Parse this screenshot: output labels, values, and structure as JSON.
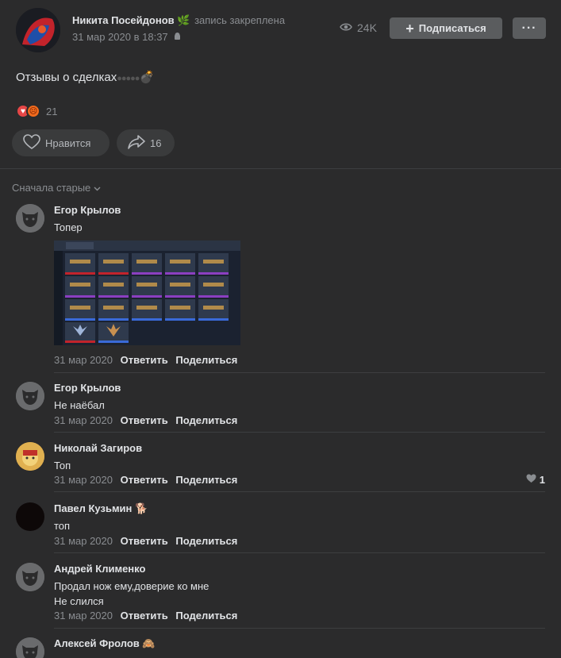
{
  "post": {
    "author": "Никита Посейдонов",
    "pinned": "запись закреплена",
    "date": "31 мар 2020 в 18:37",
    "views": "24K",
    "subscribe_label": "Подписаться",
    "more_label": "···",
    "text": "Отзывы о сделках",
    "reactions_count": "21",
    "like_label": "Нравится",
    "share_count": "16"
  },
  "comments_header": {
    "sort_label": "Сначала старые"
  },
  "comments": [
    {
      "author": "Егор Крылов",
      "text": "Топер",
      "date": "31 мар 2020",
      "reply": "Ответить",
      "share": "Поделиться"
    },
    {
      "author": "Егор Крылов",
      "text": "Не наёбал",
      "date": "31 мар 2020",
      "reply": "Ответить",
      "share": "Поделиться"
    },
    {
      "author": "Николай Загиров",
      "text": "Топ",
      "date": "31 мар 2020",
      "reply": "Ответить",
      "share": "Поделиться",
      "likes": "1"
    },
    {
      "author": "Павел Кузьмин",
      "text": "топ",
      "date": "31 мар 2020",
      "reply": "Ответить",
      "share": "Поделиться"
    },
    {
      "author": "Андрей Клименко",
      "text_line1": "Продал нож ему,доверие ко мне",
      "text_line2": "Не слился",
      "date": "31 мар 2020",
      "reply": "Ответить",
      "share": "Поделиться"
    },
    {
      "author": "Алексей Фролов"
    }
  ],
  "colors": {
    "background": "#2b2b2c",
    "button": "#5a5c5e",
    "muted": "#8a8d91",
    "text": "#e1e3e6",
    "heart": "#e64646"
  },
  "icons": [
    "eye-icon",
    "plus-icon",
    "heart-icon",
    "share-arrow-icon",
    "chevron-down-icon",
    "android-icon",
    "leaf-icon",
    "bomb-icon",
    "dog-emoji-icon",
    "monkey-emoji-icon"
  ]
}
